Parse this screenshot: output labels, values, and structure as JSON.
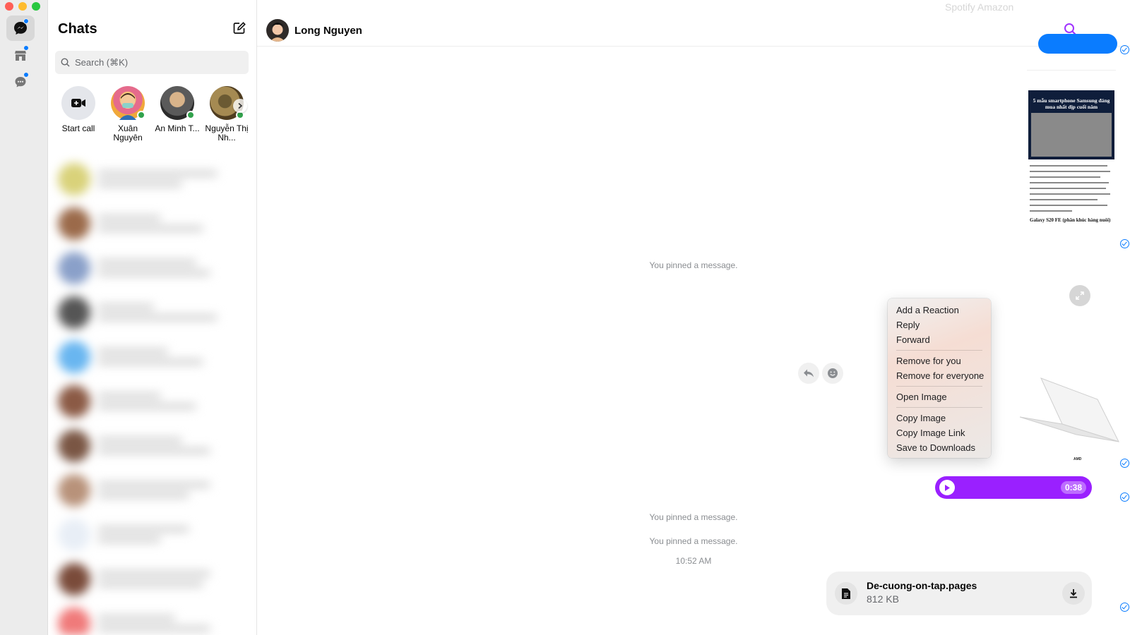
{
  "window": {
    "traffic_lights": [
      "close",
      "minimize",
      "zoom"
    ]
  },
  "rail": {
    "items": [
      {
        "icon": "chat-bubble-icon",
        "active": true,
        "badge": true
      },
      {
        "icon": "marketplace-icon",
        "active": false,
        "badge": true
      },
      {
        "icon": "requests-icon",
        "active": false,
        "badge": true
      }
    ]
  },
  "sidebar": {
    "title": "Chats",
    "compose_icon": "compose-icon",
    "search": {
      "placeholder": "Search (⌘K)",
      "value": ""
    },
    "stories": [
      {
        "label": "Start call",
        "icon": "video-call-icon"
      },
      {
        "label": "Xuân Nguyên",
        "online": true
      },
      {
        "label": "An Minh T...",
        "online": true
      },
      {
        "label": "Nguyễn Thị Nh...",
        "online": true
      }
    ],
    "stories_next_icon": "chevron-right-icon"
  },
  "header": {
    "contact_name": "Long Nguyen",
    "ghost_text": "Spotify Amazon",
    "search_icon": "search-icon",
    "more_icon": "more-icon"
  },
  "chat": {
    "pinned_1": "You pinned a message.",
    "pinned_2": "You pinned a message.",
    "pinned_3": "You pinned a message.",
    "timestamp": "10:52 AM",
    "shared_image": {
      "headline": "5 mẫu smartphone Samsung đáng mua nhất dịp cuối năm",
      "caption": "Galaxy S20 FE (phân khúc hàng nuôi)"
    },
    "laptop_brand": "AMD",
    "voice": {
      "duration": "0:38"
    },
    "file": {
      "name": "De-cuong-on-tap.pages",
      "size": "812 KB"
    }
  },
  "context_menu": {
    "group_1": [
      "Add a Reaction",
      "Reply",
      "Forward"
    ],
    "group_2": [
      "Remove for you",
      "Remove for everyone"
    ],
    "group_3": [
      "Open Image"
    ],
    "group_4": [
      "Copy Image",
      "Copy Image Link",
      "Save to Downloads"
    ]
  },
  "colors": {
    "accent": "#0a7cff",
    "voice_bubble": "#9a20ff",
    "header_icons": "#a033ff",
    "online": "#31a24c"
  }
}
